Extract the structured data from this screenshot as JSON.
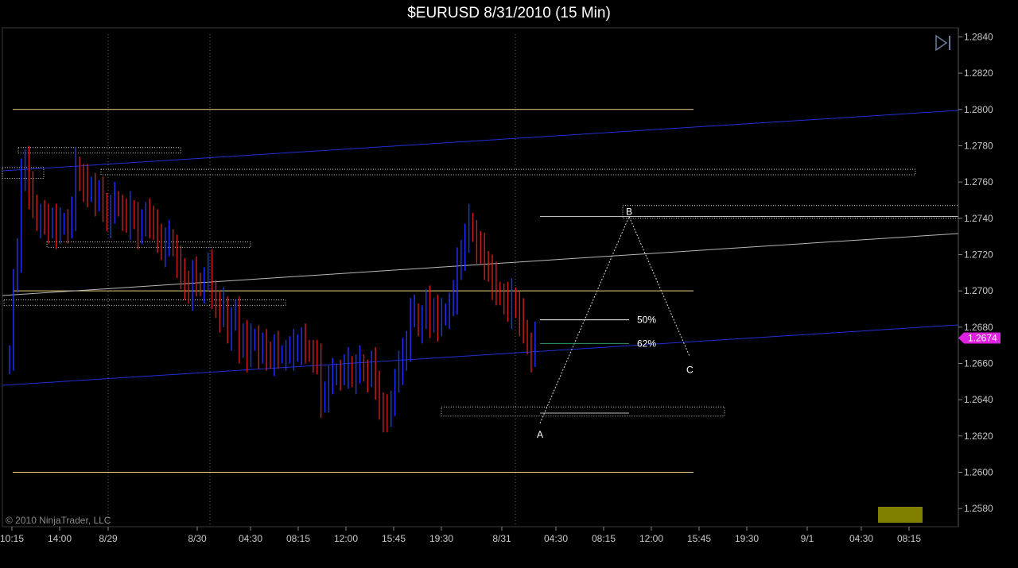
{
  "title": "$EURUSD  8/31/2010 (15 Min)",
  "copyright": "© 2010 NinjaTrader, LLC",
  "last_price": "1.2674",
  "colors": {
    "background": "#000000",
    "up_bar": "#2233ff",
    "down_bar": "#cc1f1f",
    "channel_line": "#1f2fd6",
    "horizontal_level": "#f0d080",
    "trend_line": "#b8b8b8",
    "zone_border": "#cfcfcf",
    "price_marker": "#e020e0",
    "marker_box": "#807f00",
    "fib_50": "#ffffff",
    "fib_62": "#2e9a6a"
  },
  "icons": [
    "next-bar-icon"
  ],
  "chart_data": {
    "type": "candlestick",
    "ylim": [
      1.257,
      1.2845
    ],
    "y_ticks": [
      "1.2580",
      "1.2600",
      "1.2620",
      "1.2640",
      "1.2660",
      "1.2680",
      "1.2700",
      "1.2720",
      "1.2740",
      "1.2760",
      "1.2780",
      "1.2800",
      "1.2820",
      "1.2840"
    ],
    "x_ticks": [
      "10:15",
      "14:00",
      "8/29",
      "8/30",
      "04:30",
      "08:15",
      "12:00",
      "15:45",
      "19:30",
      "8/31",
      "04:30",
      "08:15",
      "12:00",
      "15:45",
      "19:30",
      "9/1",
      "04:30",
      "08:15"
    ],
    "session_dividers": [
      "8/29",
      "8/30",
      "8/31"
    ],
    "horizontal_levels": [
      1.28,
      1.27,
      1.26
    ],
    "pattern_points": {
      "A": {
        "label": "A",
        "price": 1.2627
      },
      "B": {
        "label": "B",
        "price": 1.2741
      },
      "C": {
        "label": "C",
        "price": 1.2664
      }
    },
    "fib_levels": [
      {
        "label": "50%",
        "price": 1.2684
      },
      {
        "label": "62%",
        "price": 1.2671
      }
    ],
    "zones": [
      {
        "from": 1.2776,
        "to": 1.2779
      },
      {
        "from": 1.2762,
        "to": 1.2768
      },
      {
        "from": 1.2764,
        "to": 1.2767
      },
      {
        "from": 1.2724,
        "to": 1.2727
      },
      {
        "from": 1.2692,
        "to": 1.2695
      },
      {
        "from": 1.274,
        "to": 1.2747
      },
      {
        "from": 1.2631,
        "to": 1.2636
      }
    ],
    "closes": [
      1.2665,
      1.2705,
      1.272,
      1.2762,
      1.2772,
      1.2756,
      1.2748,
      1.2738,
      1.2741,
      1.2737,
      1.2736,
      1.274,
      1.2734,
      1.2736,
      1.2738,
      1.2735,
      1.2743,
      1.2768,
      1.2762,
      1.276,
      1.2754,
      1.2758,
      1.275,
      1.2752,
      1.2748,
      1.274,
      1.2745,
      1.275,
      1.2746,
      1.2742,
      1.2738,
      1.2744,
      1.2741,
      1.2734,
      1.2735,
      1.2744,
      1.2738,
      1.2734,
      1.2731,
      1.2724,
      1.2727,
      1.2729,
      1.2724,
      1.2716,
      1.2707,
      1.2705,
      1.27,
      1.2709,
      1.2705,
      1.2702,
      1.2706,
      1.2712,
      1.27,
      1.2692,
      1.2688,
      1.2692,
      1.2676,
      1.2684,
      1.2686,
      1.267,
      1.2676,
      1.2666,
      1.2672,
      1.2674,
      1.2666,
      1.2668,
      1.2666,
      1.2664,
      1.2668,
      1.2665,
      1.2665,
      1.2666,
      1.2666,
      1.2668,
      1.267,
      1.2672,
      1.2668,
      1.2666,
      1.2664,
      1.266,
      1.264,
      1.2644,
      1.2651,
      1.2653,
      1.2655,
      1.2654,
      1.2656,
      1.2658,
      1.2654,
      1.2657,
      1.266,
      1.2655,
      1.2653,
      1.2658,
      1.265,
      1.2636,
      1.2633,
      1.263,
      1.264,
      1.265,
      1.2658,
      1.2663,
      1.2672,
      1.2688,
      1.2688,
      1.268,
      1.2685,
      1.2692,
      1.2684,
      1.269,
      1.2683,
      1.2686,
      1.2688,
      1.2692,
      1.2697,
      1.2713,
      1.2722,
      1.2729,
      1.2738,
      1.2732,
      1.2724,
      1.2721,
      1.2716,
      1.2712,
      1.2706,
      1.27,
      1.2697,
      1.2696,
      1.2689,
      1.2696,
      1.2692,
      1.2686,
      1.2679,
      1.267,
      1.2664,
      1.2674
    ]
  }
}
